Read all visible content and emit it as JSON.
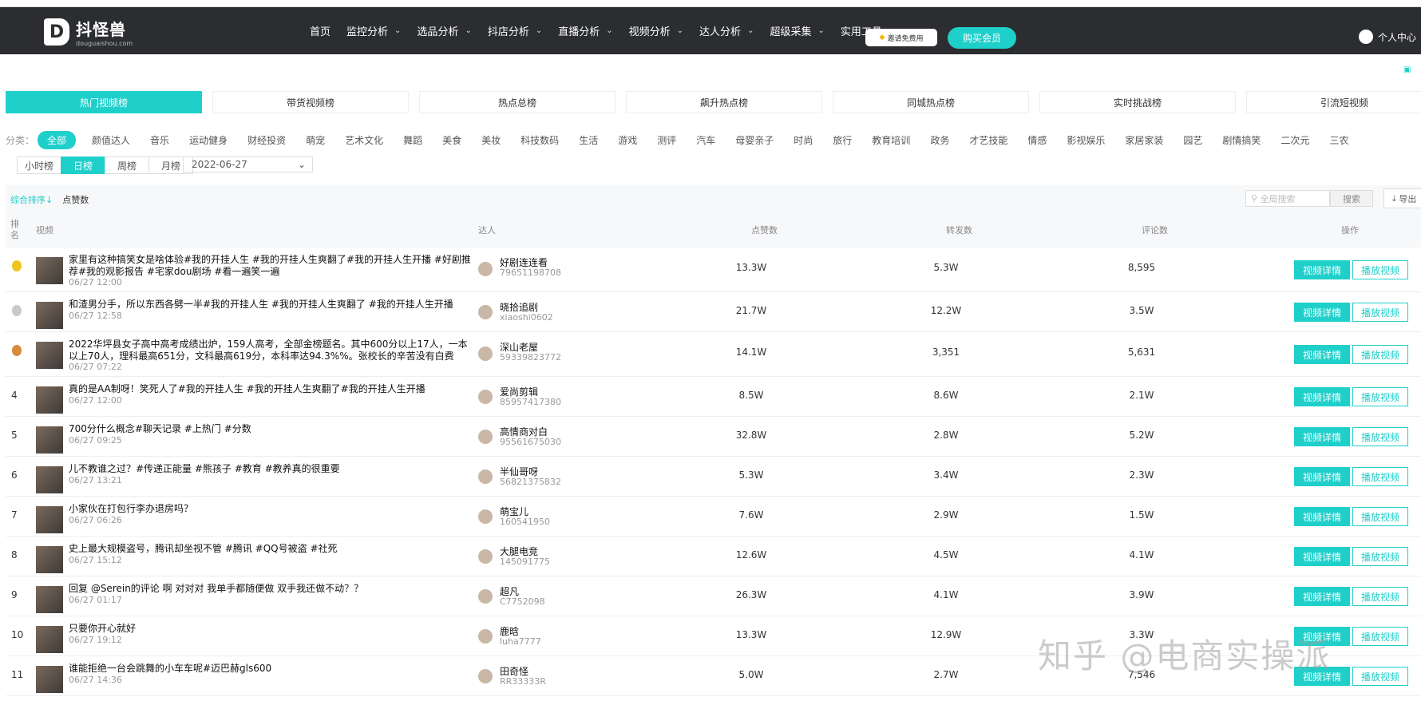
{
  "nav": {
    "logo_cn": "抖怪兽",
    "logo_en": "douguaishou.com",
    "items": [
      "首页",
      "监控分析",
      "选品分析",
      "抖店分析",
      "直播分析",
      "视频分析",
      "达人分析",
      "超级采集",
      "实用工具"
    ],
    "invite": "邀请免费用",
    "buy": "购买会员",
    "user": "个人中心"
  },
  "rank_tabs": [
    "热门视频榜",
    "带货视频榜",
    "热点总榜",
    "飙升热点榜",
    "同城热点榜",
    "实时挑战榜",
    "引流短视频"
  ],
  "categories": {
    "label": "分类：",
    "items": [
      "全部",
      "颜值达人",
      "音乐",
      "运动健身",
      "财经投资",
      "萌宠",
      "艺术文化",
      "舞蹈",
      "美食",
      "美妆",
      "科技数码",
      "生活",
      "游戏",
      "测评",
      "汽车",
      "母婴亲子",
      "时尚",
      "旅行",
      "教育培训",
      "政务",
      "才艺技能",
      "情感",
      "影视娱乐",
      "家居家装",
      "园艺",
      "剧情搞笑",
      "二次元",
      "三农"
    ]
  },
  "periods": [
    "小时榜",
    "日榜",
    "周榜",
    "月榜"
  ],
  "date": "2022-06-27",
  "toolbar": {
    "sort_a": "综合排序↓",
    "sort_b": "点赞数",
    "search_placeholder": "全局搜索",
    "search_btn": "搜索",
    "export": "导出"
  },
  "columns": {
    "rank": "排名",
    "video": "视频",
    "author": "达人",
    "likes": "点赞数",
    "shares": "转发数",
    "comments": "评论数",
    "action": "操作"
  },
  "buttons": {
    "detail": "视频详情",
    "play": "播放视频"
  },
  "rows": [
    {
      "rank": "",
      "title": "家里有这种搞笑女是啥体验#我的开挂人生 #我的开挂人生爽翻了#我的开挂人生开播 #好剧推荐#我的观影报告 #宅家dou剧场 #看一遍笑一遍",
      "date": "06/27 12:00",
      "name": "好剧连连看",
      "uid": "79651198708",
      "likes": "13.3W",
      "shares": "5.3W",
      "comments": "8,595"
    },
    {
      "rank": "",
      "title": "和渣男分手，所以东西各劈一半#我的开挂人生 #我的开挂人生爽翻了 #我的开挂人生开播",
      "date": "06/27 12:58",
      "name": "晓拾追剧",
      "uid": "xiaoshi0602",
      "likes": "21.7W",
      "shares": "12.2W",
      "comments": "3.5W"
    },
    {
      "rank": "",
      "title": "2022华坪县女子高中高考成绩出炉，159人高考，全部金榜题名。其中600分以上17人，一本以上70人，理科最高651分，文科最高619分，本科率达94.3%%。张校长的辛苦没有白费",
      "date": "06/27 07:22",
      "name": "深山老屋",
      "uid": "59339823772",
      "likes": "14.1W",
      "shares": "3,351",
      "comments": "5,631"
    },
    {
      "rank": "4",
      "title": "真的是AA制呀！笑死人了#我的开挂人生 #我的开挂人生爽翻了#我的开挂人生开播",
      "date": "06/27 12:00",
      "name": "爱尚剪辑",
      "uid": "85957417380",
      "likes": "8.5W",
      "shares": "8.6W",
      "comments": "2.1W"
    },
    {
      "rank": "5",
      "title": "700分什么概念#聊天记录 #上热门 #分数",
      "date": "06/27 09:25",
      "name": "高情商对白",
      "uid": "95561675030",
      "likes": "32.8W",
      "shares": "2.8W",
      "comments": "5.2W"
    },
    {
      "rank": "6",
      "title": "儿不教谁之过？#传递正能量 #熊孩子 #教育 #教养真的很重要",
      "date": "06/27 13:21",
      "name": "半仙哥呀",
      "uid": "56821375832",
      "likes": "5.3W",
      "shares": "3.4W",
      "comments": "2.3W"
    },
    {
      "rank": "7",
      "title": "小家伙在打包行李办退房吗？",
      "date": "06/27 06:26",
      "name": "萌宝儿",
      "uid": "160541950",
      "likes": "7.6W",
      "shares": "2.9W",
      "comments": "1.5W"
    },
    {
      "rank": "8",
      "title": "史上最大规模盗号，腾讯却坐视不管 #腾讯 #QQ号被盗 #社死",
      "date": "06/27 15:12",
      "name": "大腿电竞",
      "uid": "145091775",
      "likes": "12.6W",
      "shares": "4.5W",
      "comments": "4.1W"
    },
    {
      "rank": "9",
      "title": "回复 @Serein的评论 啊 对对对 我单手都随便做 双手我还做不动？？",
      "date": "06/27 01:17",
      "name": "超凡",
      "uid": "C7752098",
      "likes": "26.3W",
      "shares": "4.1W",
      "comments": "3.9W"
    },
    {
      "rank": "10",
      "title": "只要你开心就好",
      "date": "06/27 19:12",
      "name": "鹿晗",
      "uid": "luha7777",
      "likes": "13.3W",
      "shares": "12.9W",
      "comments": "3.3W"
    },
    {
      "rank": "11",
      "title": "谁能拒绝一台会跳舞的小车车呢#迈巴赫gls600",
      "date": "06/27 14:36",
      "name": "田奇怪",
      "uid": "RR33333R",
      "likes": "5.0W",
      "shares": "2.7W",
      "comments": "7,546"
    }
  ],
  "watermark": "知乎 @电商实操派",
  "colors": {
    "accent": "#1fcfca",
    "nav_bg": "#2b2d30"
  }
}
